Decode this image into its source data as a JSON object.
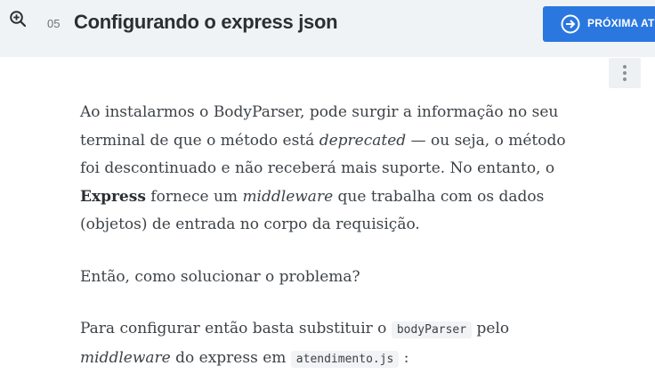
{
  "header": {
    "lesson_number": "05",
    "lesson_title": "Configurando o express json",
    "next_button_label": "PRÓXIMA ATIVIDADE"
  },
  "article": {
    "p1": {
      "t1": "Ao instalarmos o BodyParser, pode surgir a informação no seu terminal de que o método está ",
      "em1": "deprecated",
      "t2": " — ou seja, o método foi descontinuado e não receberá mais suporte. No entanto, o ",
      "strong1": "Express",
      "t3": " fornece um ",
      "em2": "middleware",
      "t4": " que trabalha com os dados (objetos) de entrada no corpo da requisição."
    },
    "p2": "Então, como solucionar o problema?",
    "p3": {
      "t1": "Para configurar então basta substituir o ",
      "code1": "bodyParser",
      "t2": " pelo ",
      "em1": "middleware",
      "t3": " do express em ",
      "code2": "atendimento.js",
      "t4": " :"
    }
  },
  "colors": {
    "topbar": "#f0f3f5",
    "accent": "#2a77e0",
    "text": "#3d4247"
  },
  "icons": {
    "zoom": "zoom-in-icon",
    "next": "arrow-right-circle-icon",
    "more": "more-vertical-icon"
  }
}
